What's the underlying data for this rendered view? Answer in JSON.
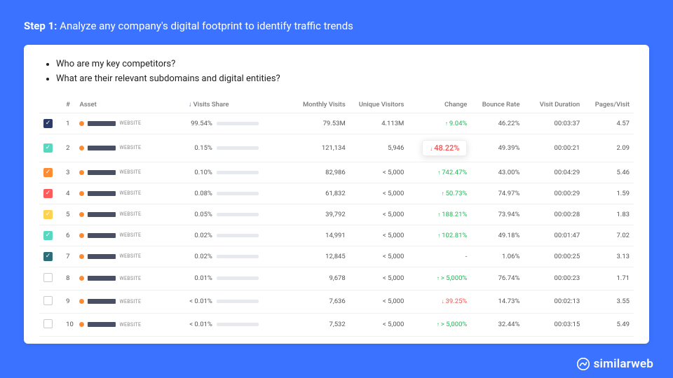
{
  "header": {
    "step": "Step 1:",
    "desc": "Analyze any company's digital footprint to identify traffic trends"
  },
  "questions": [
    "Who are my key competitors?",
    "What are their relevant subdomains and digital entities?"
  ],
  "columns": {
    "num": "#",
    "asset": "Asset",
    "share": "Visits Share",
    "monthly": "Monthly Visits",
    "unique": "Unique Visitors",
    "change": "Change",
    "bounce": "Bounce Rate",
    "duration": "Visit Duration",
    "pages": "Pages/Visit"
  },
  "rows": [
    {
      "n": "1",
      "chk": true,
      "chkColor": "#2b3a67",
      "share": "99.54%",
      "sharePct": 99.5,
      "monthly": "79.53M",
      "unique": "4.113M",
      "change": "9.04%",
      "dir": "up",
      "bounce": "46.22%",
      "duration": "00:03:37",
      "pages": "4.57",
      "assetTag": "WEBSITE"
    },
    {
      "n": "2",
      "chk": true,
      "chkColor": "#57d9c1",
      "share": "0.15%",
      "sharePct": 6,
      "monthly": "121,134",
      "unique": "5,946",
      "change": "48.22%",
      "dir": "down",
      "callout": true,
      "bounce": "49.39%",
      "duration": "00:00:21",
      "pages": "2.09",
      "assetTag": "WEBSITE"
    },
    {
      "n": "3",
      "chk": true,
      "chkColor": "#ff8c32",
      "share": "0.10%",
      "sharePct": 5,
      "monthly": "82,986",
      "unique": "< 5,000",
      "change": "742.47%",
      "dir": "up",
      "bounce": "43.00%",
      "duration": "00:04:29",
      "pages": "5.46",
      "assetTag": "WEBSITE"
    },
    {
      "n": "4",
      "chk": true,
      "chkColor": "#ff5a5a",
      "share": "0.08%",
      "sharePct": 4,
      "monthly": "61,832",
      "unique": "< 5,000",
      "change": "50.73%",
      "dir": "up",
      "bounce": "74.97%",
      "duration": "00:00:29",
      "pages": "1.59",
      "assetTag": "WEBSITE"
    },
    {
      "n": "5",
      "chk": true,
      "chkColor": "#ffd24d",
      "share": "0.05%",
      "sharePct": 3,
      "monthly": "39,792",
      "unique": "< 5,000",
      "change": "188.21%",
      "dir": "up",
      "bounce": "73.94%",
      "duration": "00:00:28",
      "pages": "1.83",
      "assetTag": "WEBSITE"
    },
    {
      "n": "6",
      "chk": true,
      "chkColor": "#57d9c1",
      "share": "0.02%",
      "sharePct": 2,
      "monthly": "14,991",
      "unique": "< 5,000",
      "change": "102.81%",
      "dir": "up",
      "bounce": "49.18%",
      "duration": "00:01:47",
      "pages": "7.02",
      "assetTag": "WEBSITE"
    },
    {
      "n": "7",
      "chk": true,
      "chkColor": "#2b6e7a",
      "share": "0.02%",
      "sharePct": 2,
      "monthly": "12,845",
      "unique": "< 5,000",
      "change": "-",
      "dir": "none",
      "bounce": "1.06%",
      "duration": "00:00:25",
      "pages": "3.13",
      "assetTag": "WEBSITE"
    },
    {
      "n": "8",
      "chk": false,
      "chkColor": "",
      "share": "0.01%",
      "sharePct": 1,
      "monthly": "9,678",
      "unique": "< 5,000",
      "change": "> 5,000%",
      "dir": "up",
      "bounce": "76.74%",
      "duration": "00:00:23",
      "pages": "1.71",
      "assetTag": "WEBSITE"
    },
    {
      "n": "9",
      "chk": false,
      "chkColor": "",
      "share": "< 0.01%",
      "sharePct": 1,
      "monthly": "7,636",
      "unique": "< 5,000",
      "change": "39.25%",
      "dir": "down",
      "bounce": "14.73%",
      "duration": "00:02:13",
      "pages": "3.55",
      "assetTag": "WEBSITE"
    },
    {
      "n": "10",
      "chk": false,
      "chkColor": "",
      "share": "< 0.01%",
      "sharePct": 1,
      "monthly": "7,532",
      "unique": "< 5,000",
      "change": "> 5,000%",
      "dir": "up",
      "bounce": "32.44%",
      "duration": "00:03:15",
      "pages": "5.49",
      "assetTag": "WEBSITE"
    }
  ],
  "brand": "similarweb"
}
